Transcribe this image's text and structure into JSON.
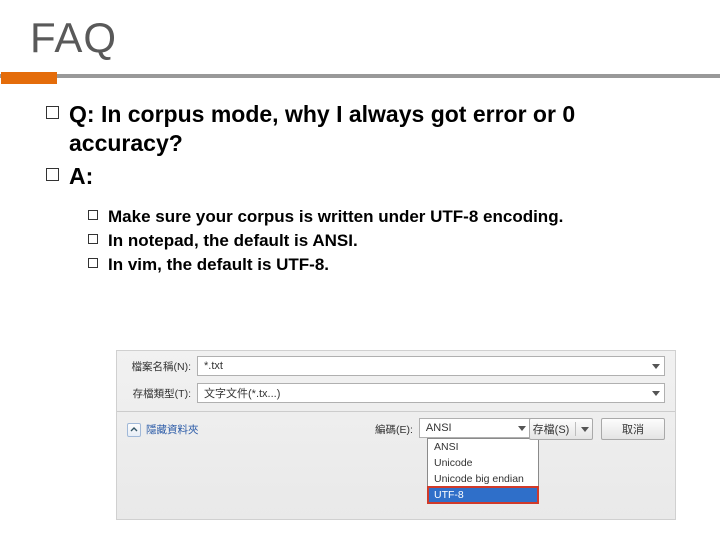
{
  "title": "FAQ",
  "q": "Q: In corpus mode, why I always got error or 0 accuracy?",
  "a": "A:",
  "subs": [
    "Make sure your corpus is written under UTF-8 encoding.",
    "In notepad, the default is ANSI.",
    "In vim, the default is UTF-8."
  ],
  "dialog": {
    "filename_label": "檔案名稱(N):",
    "filename_value": "*.txt",
    "filetype_label": "存檔類型(T):",
    "filetype_value": "文字文件(*.tx...)",
    "hide_folders": "隱藏資料夾",
    "encoding_label": "編碼(E):",
    "encoding_value": "ANSI",
    "options": [
      "ANSI",
      "Unicode",
      "Unicode big endian",
      "UTF-8"
    ],
    "save_btn": "存檔(S)",
    "cancel_btn": "取消"
  }
}
